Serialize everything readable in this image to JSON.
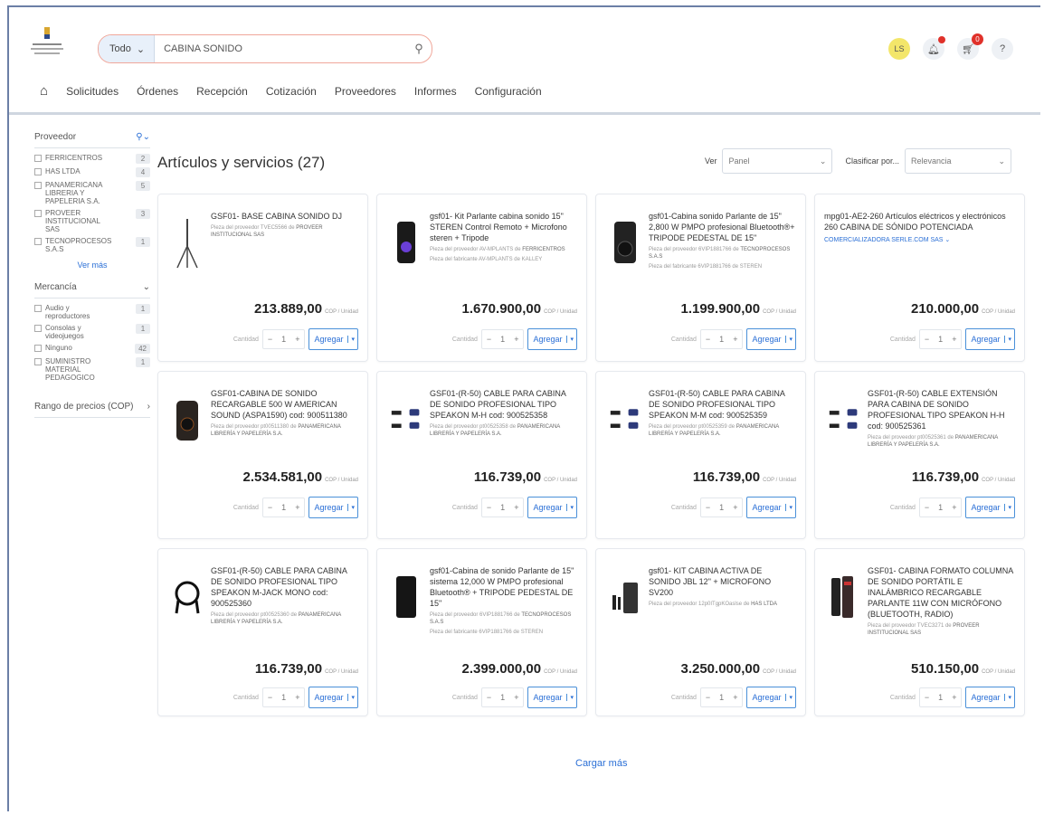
{
  "search": {
    "scope": "Todo",
    "query": "CABINA SONIDO"
  },
  "user": {
    "initials": "LS",
    "cart_count": "0"
  },
  "nav": [
    "Solicitudes",
    "Órdenes",
    "Recepción",
    "Cotización",
    "Proveedores",
    "Informes",
    "Configuración"
  ],
  "sidebar": {
    "proveedor_title": "Proveedor",
    "proveedores": [
      {
        "label": "FERRICENTROS",
        "count": "2"
      },
      {
        "label": "HAS LTDA",
        "count": "4"
      },
      {
        "label": "PANAMERICANA LIBRERIA Y PAPELERIA S.A.",
        "count": "5"
      },
      {
        "label": "PROVEER INSTITUCIONAL SAS",
        "count": "3"
      },
      {
        "label": "TECNOPROCESOS S.A.S",
        "count": "1"
      }
    ],
    "ver_mas": "Ver más",
    "mercancia_title": "Mercancía",
    "mercancias": [
      {
        "label": "Audio y reproductores",
        "count": "1"
      },
      {
        "label": "Consolas y videojuegos",
        "count": "1"
      },
      {
        "label": "Ninguno",
        "count": "42"
      },
      {
        "label": "SUMINISTRO MATERIAL PEDAGOGICO",
        "count": "1"
      }
    ],
    "rango": "Rango de precios (COP)"
  },
  "main": {
    "title": "Artículos y servicios (27)",
    "ver_label": "Ver",
    "ver_value": "Panel",
    "sort_label": "Clasificar por...",
    "sort_value": "Relevancia",
    "cantidad_label": "Cantidad",
    "qty_value": "1",
    "add_label": "Agregar",
    "unit": "COP / Unidad",
    "load_more": "Cargar más"
  },
  "products": [
    {
      "title": "GSF01- BASE CABINA SONIDO DJ",
      "meta1": "Pieza del proveedor TVEC5566 de",
      "vendor1": "PROVEER INSTITUCIONAL SAS",
      "meta2": "",
      "price": "213.889,00"
    },
    {
      "title": "gsf01- Kit Parlante cabina sonido 15\" STEREN Control Remoto + Microfono steren + Tripode",
      "meta1": "Pieza del proveedor AV-MPLANTS de",
      "vendor1": "FERRICENTROS",
      "meta2": "Pieza del fabricante AV-MPLANTS de KALLEY",
      "price": "1.670.900,00"
    },
    {
      "title": "gsf01-Cabina sonido Parlante de 15\" 2,800 W PMPO profesional Bluetooth®+ TRIPODE PEDESTAL DE 15\"",
      "meta1": "Pieza del proveedor 6VIP1881766 de",
      "vendor1": "TECNOPROCESOS S.A.S",
      "meta2": "Pieza del fabricante 6VIP1881766 de STEREN",
      "price": "1.199.900,00"
    },
    {
      "title": "mpg01-AE2-260 Artículos eléctricos y electrónicos 260 CABINA DE SÓNIDO POTENCIADA",
      "meta1": "",
      "vendor1": "",
      "meta2": "",
      "vendor_link": "COMERCIALIZADORA SERLE.COM SAS",
      "price": "210.000,00"
    },
    {
      "title": "GSF01-CABINA DE SONIDO RECARGABLE 500 W AMERICAN SOUND (ASPA1590) cod: 900511380",
      "meta1": "Pieza del proveedor pt00511380 de",
      "vendor1": "PANAMERICANA LIBRERÍA Y PAPELERÍA S.A.",
      "meta2": "",
      "price": "2.534.581,00"
    },
    {
      "title": "GSF01-(R-50) CABLE PARA CABINA DE SONIDO PROFESIONAL TIPO SPEAKON M-H cod: 900525358",
      "meta1": "Pieza del proveedor pt00525358 de",
      "vendor1": "PANAMERICANA LIBRERÍA Y PAPELERÍA S.A.",
      "meta2": "",
      "price": "116.739,00"
    },
    {
      "title": "GSF01-(R-50) CABLE PARA CABINA DE SONIDO PROFESIONAL TIPO SPEAKON M-M cod: 900525359",
      "meta1": "Pieza del proveedor pt00525359 de",
      "vendor1": "PANAMERICANA LIBRERÍA Y PAPELERÍA S.A.",
      "meta2": "",
      "price": "116.739,00"
    },
    {
      "title": "GSF01-(R-50) CABLE EXTENSIÓN PARA CABINA DE SONIDO PROFESIONAL TIPO SPEAKON H-H cod: 900525361",
      "meta1": "Pieza del proveedor pt00525361 de",
      "vendor1": "PANAMERICANA LIBRERÍA Y PAPELERÍA S.A.",
      "meta2": "",
      "price": "116.739,00"
    },
    {
      "title": "GSF01-(R-50) CABLE PARA CABINA DE SONIDO PROFESIONAL TIPO SPEAKON M-JACK MONO cod: 900525360",
      "meta1": "Pieza del proveedor pt00525360 de",
      "vendor1": "PANAMERICANA LIBRERÍA Y PAPELERÍA S.A.",
      "meta2": "",
      "price": "116.739,00"
    },
    {
      "title": "gsf01-Cabina de sonido Parlante de 15\" sistema 12,000 W PMPO profesional Bluetooth® + TRIPODE PEDESTAL DE 15\"",
      "meta1": "Pieza del proveedor 6VIP1881766 de",
      "vendor1": "TECNOPROCESOS S.A.S",
      "meta2": "Pieza del fabricante 6VIP1881766 de STEREN",
      "price": "2.399.000,00"
    },
    {
      "title": "gsf01- KIT CABINA ACTIVA DE SONIDO JBL 12\" + MICROFONO SV200",
      "meta1": "Pieza del proveedor 12p0ITgpKOaslse de",
      "vendor1": "HAS LTDA",
      "meta2": "",
      "price": "3.250.000,00"
    },
    {
      "title": "GSF01- CABINA FORMATO COLUMNA DE SONIDO PORTÁTIL E INALÁMBRICO RECARGABLE PARLANTE 11W CON MICRÓFONO (BLUETOOTH, RADIO)",
      "meta1": "Pieza del proveedor TVEC3271 de",
      "vendor1": "PROVEER INSTITUCIONAL SAS",
      "meta2": "",
      "price": "510.150,00"
    }
  ]
}
